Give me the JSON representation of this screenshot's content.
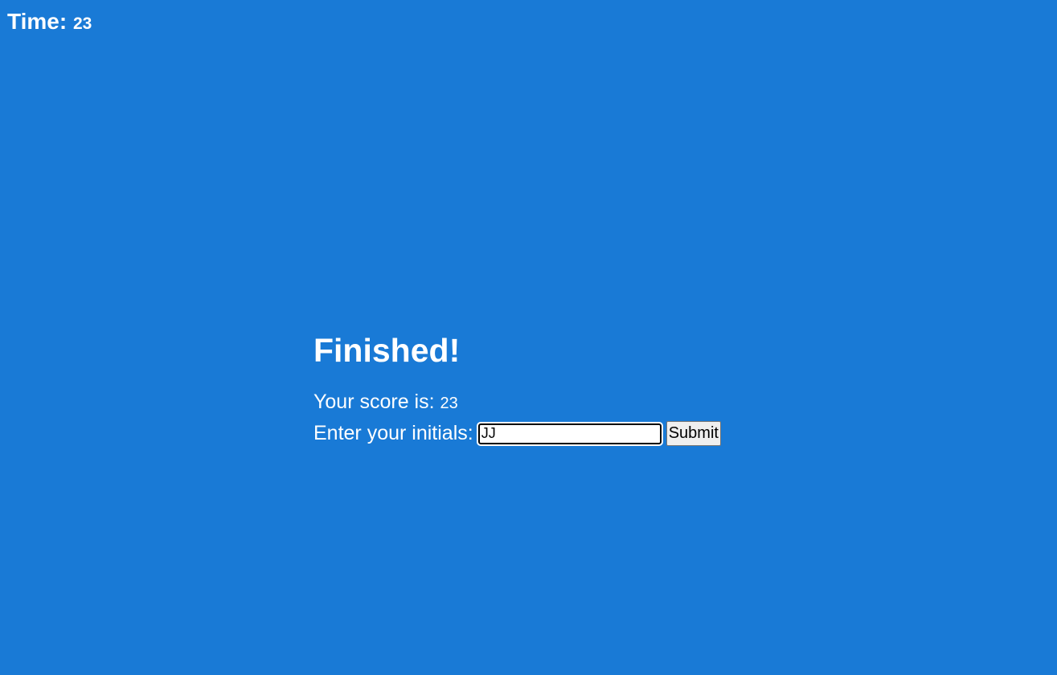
{
  "timer": {
    "label": "Time:",
    "value": "23"
  },
  "finish": {
    "title": "Finished!",
    "score_label": "Your score is:",
    "score_value": "23",
    "initials_label": "Enter your initials:",
    "initials_value": "JJ",
    "submit_label": "Submit"
  },
  "colors": {
    "background": "#197ad6",
    "text": "#ffffff"
  }
}
